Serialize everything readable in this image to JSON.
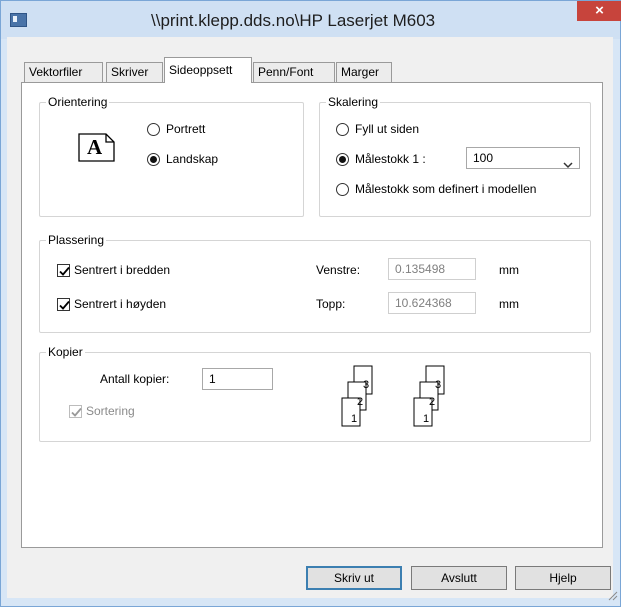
{
  "window": {
    "title": "\\\\print.klepp.dds.no\\HP Laserjet M603",
    "close_glyph": "×"
  },
  "tabs": [
    {
      "label": "Vektorfiler",
      "active": false
    },
    {
      "label": "Skriver",
      "active": false
    },
    {
      "label": "Sideoppsett",
      "active": true
    },
    {
      "label": "Penn/Font",
      "active": false
    },
    {
      "label": "Marger",
      "active": false
    }
  ],
  "orientation": {
    "legend": "Orientering",
    "icon_letter": "A",
    "portrait_label": "Portrett",
    "landscape_label": "Landskap",
    "selected": "landscape"
  },
  "scaling": {
    "legend": "Skalering",
    "fit_label": "Fyll ut siden",
    "scale_label": "Målestokk 1 :",
    "scale_value": "100",
    "model_label": "Målestokk som definert i modellen",
    "selected": "scale"
  },
  "placement": {
    "legend": "Plassering",
    "center_width_label": "Sentrert i bredden",
    "center_height_label": "Sentrert i høyden",
    "center_width_checked": true,
    "center_height_checked": true,
    "left_label": "Venstre:",
    "left_value": "0.135498",
    "top_label": "Topp:",
    "top_value": "10.624368",
    "unit_left": "mm",
    "unit_top": "mm"
  },
  "copies": {
    "legend": "Kopier",
    "count_label": "Antall kopier:",
    "count_value": "1",
    "collate_label": "Sortering",
    "collate_checked": true,
    "collate_enabled": false,
    "collated_pages": [
      "3",
      "2",
      "1"
    ],
    "uncollated_pages": [
      "3",
      "2",
      "1"
    ]
  },
  "buttons": {
    "print": "Skriv ut",
    "cancel": "Avslutt",
    "help": "Hjelp"
  },
  "colors": {
    "frame": "#d7e6f6",
    "close": "#c7443c",
    "default_button_border": "#3c7fb1"
  }
}
